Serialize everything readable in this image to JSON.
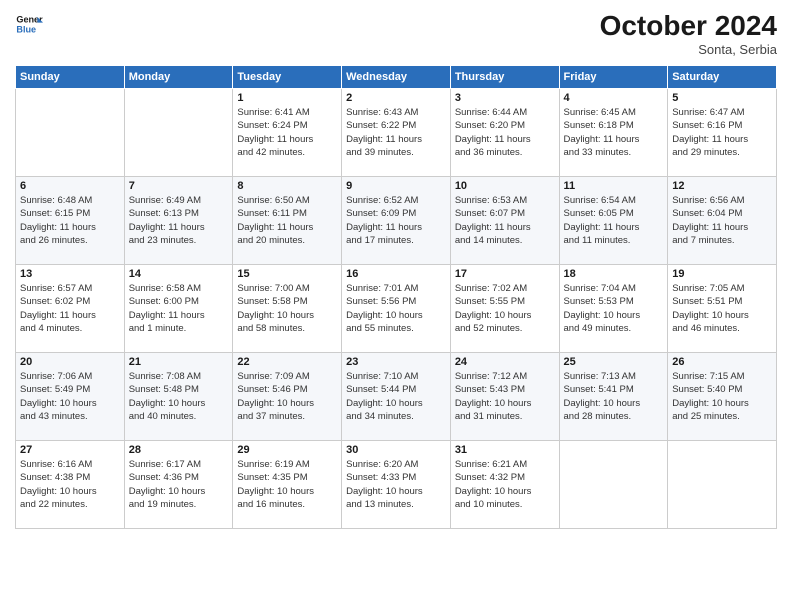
{
  "header": {
    "logo_general": "General",
    "logo_blue": "Blue",
    "month_title": "October 2024",
    "subtitle": "Sonta, Serbia"
  },
  "days_of_week": [
    "Sunday",
    "Monday",
    "Tuesday",
    "Wednesday",
    "Thursday",
    "Friday",
    "Saturday"
  ],
  "weeks": [
    [
      {
        "day": "",
        "sunrise": "",
        "sunset": "",
        "daylight": ""
      },
      {
        "day": "",
        "sunrise": "",
        "sunset": "",
        "daylight": ""
      },
      {
        "day": "1",
        "sunrise": "Sunrise: 6:41 AM",
        "sunset": "Sunset: 6:24 PM",
        "daylight": "Daylight: 11 hours and 42 minutes."
      },
      {
        "day": "2",
        "sunrise": "Sunrise: 6:43 AM",
        "sunset": "Sunset: 6:22 PM",
        "daylight": "Daylight: 11 hours and 39 minutes."
      },
      {
        "day": "3",
        "sunrise": "Sunrise: 6:44 AM",
        "sunset": "Sunset: 6:20 PM",
        "daylight": "Daylight: 11 hours and 36 minutes."
      },
      {
        "day": "4",
        "sunrise": "Sunrise: 6:45 AM",
        "sunset": "Sunset: 6:18 PM",
        "daylight": "Daylight: 11 hours and 33 minutes."
      },
      {
        "day": "5",
        "sunrise": "Sunrise: 6:47 AM",
        "sunset": "Sunset: 6:16 PM",
        "daylight": "Daylight: 11 hours and 29 minutes."
      }
    ],
    [
      {
        "day": "6",
        "sunrise": "Sunrise: 6:48 AM",
        "sunset": "Sunset: 6:15 PM",
        "daylight": "Daylight: 11 hours and 26 minutes."
      },
      {
        "day": "7",
        "sunrise": "Sunrise: 6:49 AM",
        "sunset": "Sunset: 6:13 PM",
        "daylight": "Daylight: 11 hours and 23 minutes."
      },
      {
        "day": "8",
        "sunrise": "Sunrise: 6:50 AM",
        "sunset": "Sunset: 6:11 PM",
        "daylight": "Daylight: 11 hours and 20 minutes."
      },
      {
        "day": "9",
        "sunrise": "Sunrise: 6:52 AM",
        "sunset": "Sunset: 6:09 PM",
        "daylight": "Daylight: 11 hours and 17 minutes."
      },
      {
        "day": "10",
        "sunrise": "Sunrise: 6:53 AM",
        "sunset": "Sunset: 6:07 PM",
        "daylight": "Daylight: 11 hours and 14 minutes."
      },
      {
        "day": "11",
        "sunrise": "Sunrise: 6:54 AM",
        "sunset": "Sunset: 6:05 PM",
        "daylight": "Daylight: 11 hours and 11 minutes."
      },
      {
        "day": "12",
        "sunrise": "Sunrise: 6:56 AM",
        "sunset": "Sunset: 6:04 PM",
        "daylight": "Daylight: 11 hours and 7 minutes."
      }
    ],
    [
      {
        "day": "13",
        "sunrise": "Sunrise: 6:57 AM",
        "sunset": "Sunset: 6:02 PM",
        "daylight": "Daylight: 11 hours and 4 minutes."
      },
      {
        "day": "14",
        "sunrise": "Sunrise: 6:58 AM",
        "sunset": "Sunset: 6:00 PM",
        "daylight": "Daylight: 11 hours and 1 minute."
      },
      {
        "day": "15",
        "sunrise": "Sunrise: 7:00 AM",
        "sunset": "Sunset: 5:58 PM",
        "daylight": "Daylight: 10 hours and 58 minutes."
      },
      {
        "day": "16",
        "sunrise": "Sunrise: 7:01 AM",
        "sunset": "Sunset: 5:56 PM",
        "daylight": "Daylight: 10 hours and 55 minutes."
      },
      {
        "day": "17",
        "sunrise": "Sunrise: 7:02 AM",
        "sunset": "Sunset: 5:55 PM",
        "daylight": "Daylight: 10 hours and 52 minutes."
      },
      {
        "day": "18",
        "sunrise": "Sunrise: 7:04 AM",
        "sunset": "Sunset: 5:53 PM",
        "daylight": "Daylight: 10 hours and 49 minutes."
      },
      {
        "day": "19",
        "sunrise": "Sunrise: 7:05 AM",
        "sunset": "Sunset: 5:51 PM",
        "daylight": "Daylight: 10 hours and 46 minutes."
      }
    ],
    [
      {
        "day": "20",
        "sunrise": "Sunrise: 7:06 AM",
        "sunset": "Sunset: 5:49 PM",
        "daylight": "Daylight: 10 hours and 43 minutes."
      },
      {
        "day": "21",
        "sunrise": "Sunrise: 7:08 AM",
        "sunset": "Sunset: 5:48 PM",
        "daylight": "Daylight: 10 hours and 40 minutes."
      },
      {
        "day": "22",
        "sunrise": "Sunrise: 7:09 AM",
        "sunset": "Sunset: 5:46 PM",
        "daylight": "Daylight: 10 hours and 37 minutes."
      },
      {
        "day": "23",
        "sunrise": "Sunrise: 7:10 AM",
        "sunset": "Sunset: 5:44 PM",
        "daylight": "Daylight: 10 hours and 34 minutes."
      },
      {
        "day": "24",
        "sunrise": "Sunrise: 7:12 AM",
        "sunset": "Sunset: 5:43 PM",
        "daylight": "Daylight: 10 hours and 31 minutes."
      },
      {
        "day": "25",
        "sunrise": "Sunrise: 7:13 AM",
        "sunset": "Sunset: 5:41 PM",
        "daylight": "Daylight: 10 hours and 28 minutes."
      },
      {
        "day": "26",
        "sunrise": "Sunrise: 7:15 AM",
        "sunset": "Sunset: 5:40 PM",
        "daylight": "Daylight: 10 hours and 25 minutes."
      }
    ],
    [
      {
        "day": "27",
        "sunrise": "Sunrise: 6:16 AM",
        "sunset": "Sunset: 4:38 PM",
        "daylight": "Daylight: 10 hours and 22 minutes."
      },
      {
        "day": "28",
        "sunrise": "Sunrise: 6:17 AM",
        "sunset": "Sunset: 4:36 PM",
        "daylight": "Daylight: 10 hours and 19 minutes."
      },
      {
        "day": "29",
        "sunrise": "Sunrise: 6:19 AM",
        "sunset": "Sunset: 4:35 PM",
        "daylight": "Daylight: 10 hours and 16 minutes."
      },
      {
        "day": "30",
        "sunrise": "Sunrise: 6:20 AM",
        "sunset": "Sunset: 4:33 PM",
        "daylight": "Daylight: 10 hours and 13 minutes."
      },
      {
        "day": "31",
        "sunrise": "Sunrise: 6:21 AM",
        "sunset": "Sunset: 4:32 PM",
        "daylight": "Daylight: 10 hours and 10 minutes."
      },
      {
        "day": "",
        "sunrise": "",
        "sunset": "",
        "daylight": ""
      },
      {
        "day": "",
        "sunrise": "",
        "sunset": "",
        "daylight": ""
      }
    ]
  ]
}
